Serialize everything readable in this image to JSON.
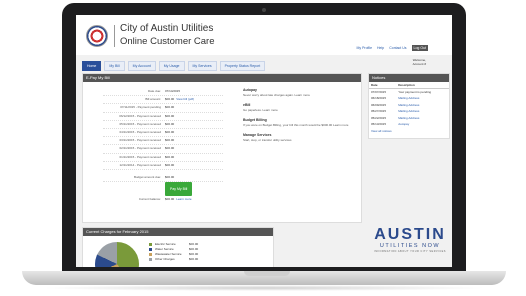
{
  "header": {
    "title": "City of Austin Utilities",
    "subtitle": "Online Customer Care",
    "links": [
      "My Profile",
      "Help",
      "Contact Us"
    ],
    "logout_label": "Log Out",
    "welcome_line1": "Welcome,",
    "welcome_line2": "Account #"
  },
  "nav": {
    "tabs": [
      "Home",
      "My Bill",
      "My Account",
      "My Usage",
      "My Services",
      "Property Status Report"
    ]
  },
  "main": {
    "panel_title": "E-Pay My Bill",
    "payments": [
      {
        "label": "Date due:",
        "value": "07/14/2015",
        "link": ""
      },
      {
        "label": "Bill amount:",
        "value": "$00.00",
        "link": "View bill (pdf)"
      },
      {
        "label": "07/11/2015 - Payment pending",
        "value": "$00.00",
        "link": ""
      },
      {
        "label": "06/12/2015 - Payment received",
        "value": "$00.00",
        "link": ""
      },
      {
        "label": "05/11/2015 - Payment received",
        "value": "$00.00",
        "link": ""
      },
      {
        "label": "04/11/2015 - Payment received",
        "value": "$00.00",
        "link": ""
      },
      {
        "label": "03/11/2015 - Payment received",
        "value": "$00.00",
        "link": ""
      },
      {
        "label": "02/11/2015 - Payment received",
        "value": "$00.00",
        "link": ""
      },
      {
        "label": "01/11/2015 - Payment received",
        "value": "$00.00",
        "link": ""
      },
      {
        "label": "12/11/2014 - Payment received",
        "value": "$00.00",
        "link": ""
      }
    ],
    "budget_label": "Budget amount due:",
    "budget_value": "$00.00",
    "pay_button": "Pay My Bill",
    "balance_label": "Current balance:",
    "balance_value": "$00.00",
    "balance_link": "Learn more",
    "right_col": [
      {
        "title": "Autopay",
        "text": "Never worry about late charges again. Learn more"
      },
      {
        "title": "eBill",
        "text": "Go paperless. Learn more"
      },
      {
        "title": "Budget Billing",
        "text": "If you were on Budget Billing, your bill this month would be $000.00 Learn more"
      },
      {
        "title": "Manage Services",
        "text": "Start, stop, or transfer utility services"
      }
    ]
  },
  "notices": {
    "title": "Notices",
    "col_date": "Date",
    "col_desc": "Description",
    "rows": [
      {
        "date": "07/07/2015",
        "desc": "Your payment is pending"
      },
      {
        "date": "06/18/2015",
        "desc": "Mailing Address"
      },
      {
        "date": "06/09/2015",
        "desc": "Mailing Address"
      },
      {
        "date": "05/27/2015",
        "desc": "Mailing Address"
      },
      {
        "date": "05/22/2015",
        "desc": "Mailing Address"
      },
      {
        "date": "05/13/2015",
        "desc": "Autopay"
      }
    ],
    "view_all": "View all notices"
  },
  "charges": {
    "title": "Current Charges for February 2015",
    "items": [
      {
        "label": "Electric Service",
        "value": "$00.00",
        "color": "#7a9a3a"
      },
      {
        "label": "Water Service",
        "value": "$00.00",
        "color": "#2b4a8c"
      },
      {
        "label": "Wastewater Service",
        "value": "$00.00",
        "color": "#c9a15c"
      },
      {
        "label": "Other Charges",
        "value": "$00.00",
        "color": "#9aa0a6"
      }
    ]
  },
  "brand": {
    "word": "AUSTIN",
    "sub": "UTILITIES NOW",
    "tag": "INFORMATION ABOUT YOUR CITY SERVICES"
  }
}
